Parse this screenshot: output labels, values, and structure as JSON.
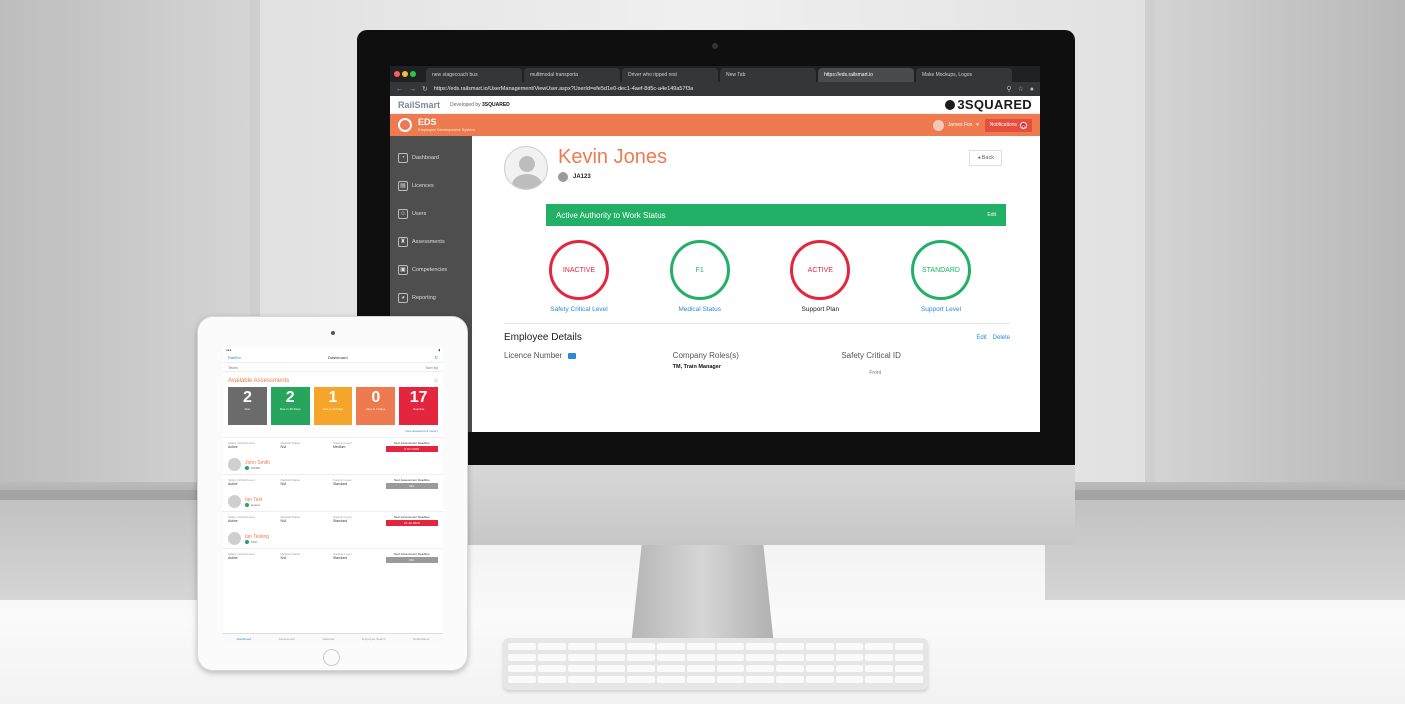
{
  "browser": {
    "tabs": [
      {
        "label": "new stagecoach bus"
      },
      {
        "label": "multimodal transporta"
      },
      {
        "label": "Driver who ripped rest"
      },
      {
        "label": "New Tab"
      },
      {
        "label": "https://eds.railsmart.io"
      },
      {
        "label": "Make Mockups, Logos"
      }
    ],
    "url": "https://eds.railsmart.io/UserManagement/ViewUser.aspx?UserId=efe5d1e0-dec1-4aef-8d5c-a4e149a57f3a"
  },
  "header": {
    "logo": "RailSmart",
    "developed_by": "Developed by",
    "developer": "3SQUARED",
    "brand": "3SQUARED"
  },
  "eds": {
    "title": "EDS",
    "subtitle": "Employee Development System",
    "user": "James Fox",
    "notifications_label": "Notifications",
    "notifications_count": "0"
  },
  "sidebar": {
    "items": [
      {
        "label": "Dashboard"
      },
      {
        "label": "Licences"
      },
      {
        "label": "Users"
      },
      {
        "label": "Assessments"
      },
      {
        "label": "Competencies"
      },
      {
        "label": "Reporting"
      }
    ]
  },
  "profile": {
    "name": "Kevin Jones",
    "employee_id": "JA123",
    "back": "◂ Back"
  },
  "status": {
    "title": "Active Authority to Work Status",
    "edit": "Edit",
    "circles": [
      {
        "value": "INACTIVE",
        "label": "Safety Critical Level",
        "color": "#e3253d"
      },
      {
        "value": "F1",
        "label": "Medical Status",
        "color": "#21b066"
      },
      {
        "value": "ACTIVE",
        "label": "Support Plan",
        "color": "#e3253d"
      },
      {
        "value": "STANDARD",
        "label": "Support Level",
        "color": "#21b066"
      }
    ]
  },
  "details": {
    "title": "Employee Details",
    "edit": "Edit",
    "delete": "Delete",
    "licence_label": "Licence Number",
    "roles_label": "Company Roles(s)",
    "roles_value": "TM, Train Manager",
    "safety_id_label": "Safety Critical ID",
    "safety_id_sub": "Front"
  },
  "ipad": {
    "nav_left": "RailSm",
    "nav_title": "Dashboard",
    "search_label": "Team",
    "search_right": "Sort by",
    "section_title": "Available Assessments",
    "tiles": [
      {
        "n": "2",
        "s": "Due",
        "color": "#6b6b6b"
      },
      {
        "n": "2",
        "s": "Due in 30 Days",
        "color": "#27a55c"
      },
      {
        "n": "1",
        "s": "Due in 14 Days",
        "color": "#f4a52a"
      },
      {
        "n": "0",
        "s": "Due in 7 Days",
        "color": "#ee7a4f"
      },
      {
        "n": "17",
        "s": "Overdue",
        "color": "#e3253d"
      }
    ],
    "link": "View assessment history",
    "col_headers": [
      "Safety Critical Level",
      "Medical Status",
      "Support Level"
    ],
    "next_label": "Next Assessment Deadline",
    "rows": [
      {
        "name": "",
        "id": "",
        "vals": [
          "Active",
          "N/A",
          "Medium"
        ],
        "deadline": "8 Oct 2018",
        "dl_color": "red"
      },
      {
        "name": "John Smith",
        "id": "SS400",
        "vals": [
          "Active",
          "N/A",
          "Standard"
        ],
        "deadline": "N/A",
        "dl_color": "gray"
      },
      {
        "name": "Ian Test",
        "id": "jestest",
        "vals": [
          "Active",
          "N/A",
          "Standard"
        ],
        "deadline": "25 Jul 2018",
        "dl_color": "red"
      },
      {
        "name": "Ian Testing",
        "id": "1927",
        "vals": [
          "Active",
          "N/A",
          "Standard"
        ],
        "deadline": "N/A",
        "dl_color": "gray"
      }
    ],
    "tabbar": [
      "Dashboard",
      "Assessment",
      "Calendar",
      "Employee Search",
      "Notifications"
    ]
  }
}
